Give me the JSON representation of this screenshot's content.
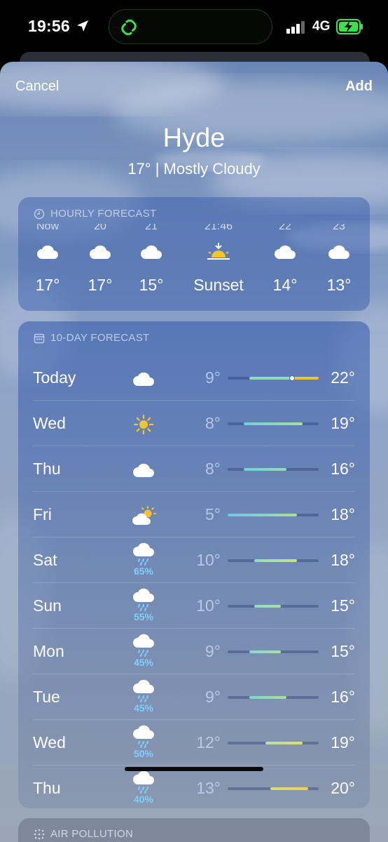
{
  "status_bar": {
    "time": "19:56",
    "network": "4G"
  },
  "header": {
    "cancel_label": "Cancel",
    "add_label": "Add"
  },
  "location": {
    "city": "Hyde",
    "current": "17°  |  Mostly Cloudy"
  },
  "hourly": {
    "title": "HOURLY FORECAST",
    "items": [
      {
        "time": "Now",
        "icon": "cloud-icon",
        "value": "17°"
      },
      {
        "time": "20",
        "icon": "cloud-icon",
        "value": "17°"
      },
      {
        "time": "21",
        "icon": "cloud-icon",
        "value": "15°"
      },
      {
        "time": "21:46",
        "icon": "sunset-icon",
        "value": "Sunset"
      },
      {
        "time": "22",
        "icon": "cloud-icon",
        "value": "14°"
      },
      {
        "time": "23",
        "icon": "cloud-icon",
        "value": "13°"
      }
    ]
  },
  "forecast": {
    "title": "10-DAY FORECAST",
    "range": {
      "min": 5,
      "max": 22
    },
    "days": [
      {
        "day": "Today",
        "icon": "cloud-icon",
        "precip": "",
        "low": "9°",
        "high": "22°",
        "low_val": 9,
        "high_val": 22,
        "current_val": 17,
        "colors": [
          "#8fe0b0",
          "#f2c230"
        ]
      },
      {
        "day": "Wed",
        "icon": "sun-icon",
        "precip": "",
        "low": "8°",
        "high": "19°",
        "low_val": 8,
        "high_val": 19,
        "colors": [
          "#70d0d8",
          "#a8e09a"
        ]
      },
      {
        "day": "Thu",
        "icon": "cloud-icon",
        "precip": "",
        "low": "8°",
        "high": "16°",
        "low_val": 8,
        "high_val": 16,
        "colors": [
          "#70d0d8",
          "#90dcc0"
        ]
      },
      {
        "day": "Fri",
        "icon": "partly-sunny-icon",
        "precip": "",
        "low": "5°",
        "high": "18°",
        "low_val": 5,
        "high_val": 18,
        "colors": [
          "#6cc8e8",
          "#a8e09a"
        ]
      },
      {
        "day": "Sat",
        "icon": "rain-icon",
        "precip": "65%",
        "low": "10°",
        "high": "18°",
        "low_val": 10,
        "high_val": 18,
        "colors": [
          "#90dcc0",
          "#c8e28a"
        ]
      },
      {
        "day": "Sun",
        "icon": "rain-icon",
        "precip": "55%",
        "low": "10°",
        "high": "15°",
        "low_val": 10,
        "high_val": 15,
        "colors": [
          "#90dcc0",
          "#a8e0a8"
        ]
      },
      {
        "day": "Mon",
        "icon": "rain-icon",
        "precip": "45%",
        "low": "9°",
        "high": "15°",
        "low_val": 9,
        "high_val": 15,
        "colors": [
          "#88d8cc",
          "#a8e0a8"
        ]
      },
      {
        "day": "Tue",
        "icon": "rain-icon",
        "precip": "45%",
        "low": "9°",
        "high": "16°",
        "low_val": 9,
        "high_val": 16,
        "colors": [
          "#80d4d4",
          "#a8e09a"
        ]
      },
      {
        "day": "Wed",
        "icon": "rain-icon",
        "precip": "50%",
        "low": "12°",
        "high": "19°",
        "low_val": 12,
        "high_val": 19,
        "colors": [
          "#b8e09a",
          "#e0dc70"
        ]
      },
      {
        "day": "Thu",
        "icon": "rain-icon",
        "precip": "40%",
        "low": "13°",
        "high": "20°",
        "low_val": 13,
        "high_val": 20,
        "colors": [
          "#d8dc78",
          "#ead258"
        ]
      }
    ]
  },
  "air_pollution": {
    "title": "AIR POLLUTION"
  }
}
